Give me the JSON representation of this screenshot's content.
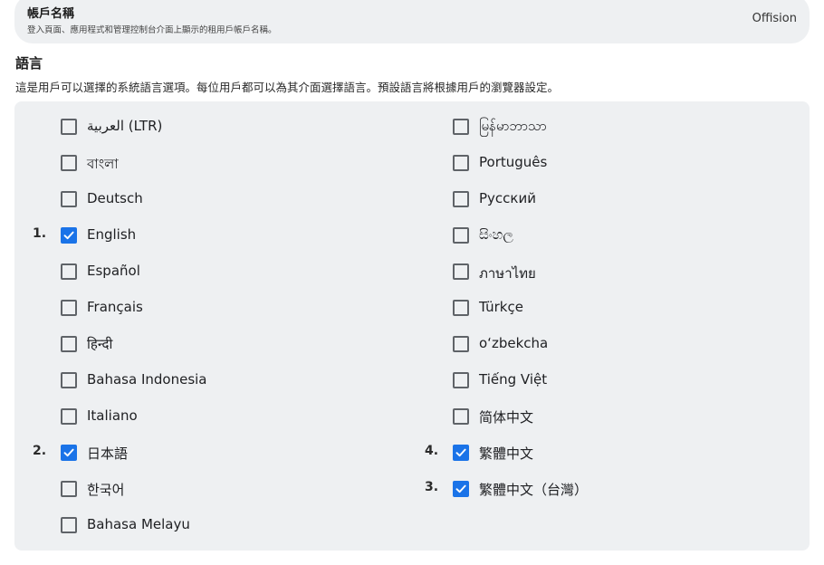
{
  "account": {
    "title": "帳戶名稱",
    "description": "登入頁面、應用程式和管理控制台介面上顯示的租用戶帳戶名稱。",
    "value": "Offision"
  },
  "language": {
    "heading": "語言",
    "description": "這是用戶可以選擇的系統語言選項。每位用戶都可以為其介面選擇語言。預設語言將根據用戶的瀏覽器設定。",
    "accent_color": "#1a73e8",
    "left_column": [
      {
        "label": "العربية (LTR)",
        "checked": false,
        "order": ""
      },
      {
        "label": "বাংলা",
        "checked": false,
        "order": ""
      },
      {
        "label": "Deutsch",
        "checked": false,
        "order": ""
      },
      {
        "label": "English",
        "checked": true,
        "order": "1."
      },
      {
        "label": "Español",
        "checked": false,
        "order": ""
      },
      {
        "label": "Français",
        "checked": false,
        "order": ""
      },
      {
        "label": "हिन्दी",
        "checked": false,
        "order": ""
      },
      {
        "label": "Bahasa Indonesia",
        "checked": false,
        "order": ""
      },
      {
        "label": "Italiano",
        "checked": false,
        "order": ""
      },
      {
        "label": "日本語",
        "checked": true,
        "order": "2."
      },
      {
        "label": "한국어",
        "checked": false,
        "order": ""
      },
      {
        "label": "Bahasa Melayu",
        "checked": false,
        "order": ""
      }
    ],
    "right_column": [
      {
        "label": "မြန်မာဘာသာ",
        "checked": false,
        "order": ""
      },
      {
        "label": "Português",
        "checked": false,
        "order": ""
      },
      {
        "label": "Русский",
        "checked": false,
        "order": ""
      },
      {
        "label": "සිංහල",
        "checked": false,
        "order": ""
      },
      {
        "label": "ภาษาไทย",
        "checked": false,
        "order": ""
      },
      {
        "label": "Türkçe",
        "checked": false,
        "order": ""
      },
      {
        "label": "oʻzbekcha",
        "checked": false,
        "order": ""
      },
      {
        "label": "Tiếng Việt",
        "checked": false,
        "order": ""
      },
      {
        "label": "简体中文",
        "checked": false,
        "order": ""
      },
      {
        "label": "繁體中文",
        "checked": true,
        "order": "4."
      },
      {
        "label": "繁體中文（台灣）",
        "checked": true,
        "order": "3."
      }
    ]
  }
}
